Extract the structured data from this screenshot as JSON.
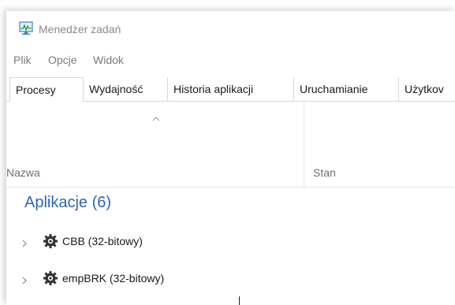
{
  "window": {
    "title": "Menedżer zadań"
  },
  "menu": {
    "items": [
      {
        "label": "Plik"
      },
      {
        "label": "Opcje"
      },
      {
        "label": "Widok"
      }
    ]
  },
  "tabs": [
    {
      "label": "Procesy",
      "active": true
    },
    {
      "label": "Wydajność"
    },
    {
      "label": "Historia aplikacji"
    },
    {
      "label": "Uruchamianie"
    },
    {
      "label": "Użytkov"
    }
  ],
  "columns": {
    "name": "Nazwa",
    "status": "Stan"
  },
  "group": {
    "title": "Aplikacje (6)"
  },
  "processes": [
    {
      "name": "CBB (32-bitowy)",
      "icon": "gear-app-icon"
    },
    {
      "name": "empBRK (32-bitowy)",
      "icon": "gear-app-icon"
    }
  ],
  "colors": {
    "group_title": "#2c67b5",
    "menu_text": "#7a7a7a",
    "title_text": "#8a8a8a"
  }
}
